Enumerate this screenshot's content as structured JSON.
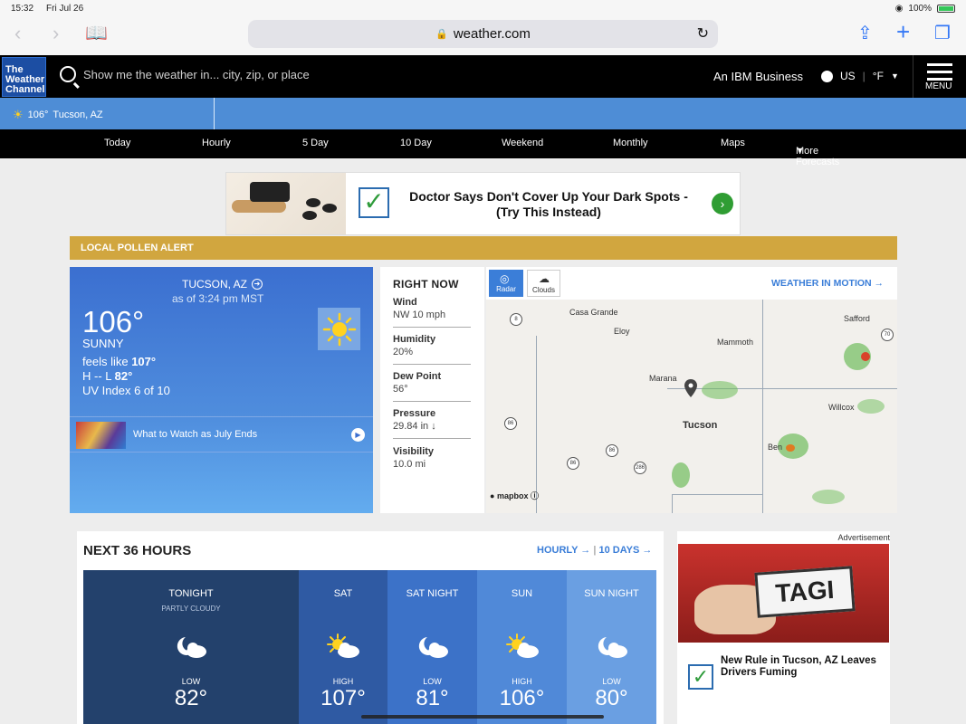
{
  "status": {
    "time": "15:32",
    "date": "Fri Jul 26",
    "battery": "100%"
  },
  "browser": {
    "url": "weather.com"
  },
  "header": {
    "logo_line1": "The",
    "logo_line2": "Weather",
    "logo_line3": "Channel",
    "search_placeholder": "Show me the weather in... city, zip, or place",
    "ibm": "An IBM Business",
    "region": "US",
    "unit": "°F",
    "menu_label": "MENU"
  },
  "location_bar": {
    "temp": "106°",
    "place": "Tucson, AZ"
  },
  "nav": [
    "Today",
    "Hourly",
    "5 Day",
    "10 Day",
    "Weekend",
    "Monthly",
    "Maps",
    "More Forecasts"
  ],
  "top_ad": {
    "text": "Doctor Says Don't Cover Up Your Dark Spots - (Try This Instead)"
  },
  "pollen_alert": "LOCAL POLLEN ALERT",
  "current": {
    "location": "TUCSON, AZ",
    "as_of": "as of 3:24 pm MST",
    "temp": "106°",
    "phrase": "SUNNY",
    "feels_like_label": "feels like",
    "feels_like": "107°",
    "hi_lo_prefix": "H -- L",
    "low": "82°",
    "uv": "UV Index 6 of 10",
    "video_title": "What to Watch as July Ends"
  },
  "right_now": {
    "title": "RIGHT NOW",
    "items": [
      {
        "label": "Wind",
        "value": "NW 10 mph"
      },
      {
        "label": "Humidity",
        "value": "20%"
      },
      {
        "label": "Dew Point",
        "value": "56°"
      },
      {
        "label": "Pressure",
        "value": "29.84 in ↓"
      },
      {
        "label": "Visibility",
        "value": "10.0 mi"
      }
    ]
  },
  "map": {
    "radar_label": "Radar",
    "clouds_label": "Clouds",
    "weather_in_motion": "WEATHER IN MOTION →",
    "cities": [
      "Casa Grande",
      "Eloy",
      "Mammoth",
      "Safford",
      "Marana",
      "Tucson",
      "Willcox",
      "Ben"
    ],
    "highways": [
      "8",
      "70",
      "86",
      "86",
      "86",
      "286"
    ],
    "attribution": "mapbox"
  },
  "forecast": {
    "title": "NEXT 36 HOURS",
    "hourly_link": "HOURLY →",
    "ten_day_link": "10 DAYS →",
    "periods": [
      {
        "name": "TONIGHT",
        "sub": "PARTLY CLOUDY",
        "hl": "LOW",
        "temp": "82°",
        "icon": "night-partly-cloudy-icon",
        "color": "#23416c"
      },
      {
        "name": "SAT",
        "sub": "",
        "hl": "HIGH",
        "temp": "107°",
        "icon": "day-partly-cloudy-icon",
        "color": "#2f5aa3"
      },
      {
        "name": "SAT NIGHT",
        "sub": "",
        "hl": "LOW",
        "temp": "81°",
        "icon": "night-partly-cloudy-icon",
        "color": "#3c72c8"
      },
      {
        "name": "SUN",
        "sub": "",
        "hl": "HIGH",
        "temp": "106°",
        "icon": "day-partly-cloudy-icon",
        "color": "#5089d8"
      },
      {
        "name": "SUN NIGHT",
        "sub": "",
        "hl": "LOW",
        "temp": "80°",
        "icon": "night-partly-cloudy-icon",
        "color": "#6a9fe2"
      }
    ]
  },
  "side_ad": {
    "label": "Advertisement",
    "plate_text": "TAGI",
    "text": "New Rule in Tucson, AZ Leaves Drivers Fuming"
  }
}
